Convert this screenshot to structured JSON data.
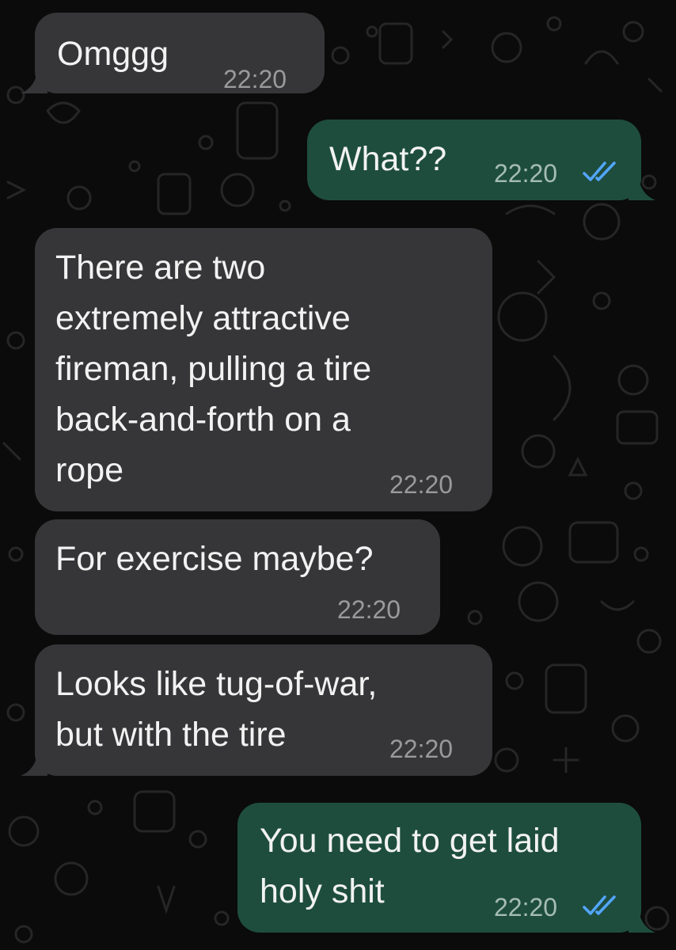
{
  "theme": {
    "incoming_color": "#363638",
    "outgoing_color": "#1e4d3e",
    "read_tick_color": "#53a6ff",
    "background": "#0b0b0b"
  },
  "messages": [
    {
      "direction": "incoming",
      "text": "Omggg",
      "time": "22:20"
    },
    {
      "direction": "outgoing",
      "text": "What??",
      "time": "22:20",
      "status": "read-ticks-icon"
    },
    {
      "direction": "incoming",
      "text": "There are two\nextremely attractive\nfireman, pulling a tire\nback-and-forth on a\nrope",
      "time": "22:20"
    },
    {
      "direction": "incoming",
      "text": "For exercise maybe?",
      "time": "22:20"
    },
    {
      "direction": "incoming",
      "text": "Looks like tug-of-war,\nbut with the tire",
      "time": "22:20"
    },
    {
      "direction": "outgoing",
      "text": "You need to get laid\nholy shit",
      "time": "22:20",
      "status": "read-ticks-icon"
    }
  ]
}
